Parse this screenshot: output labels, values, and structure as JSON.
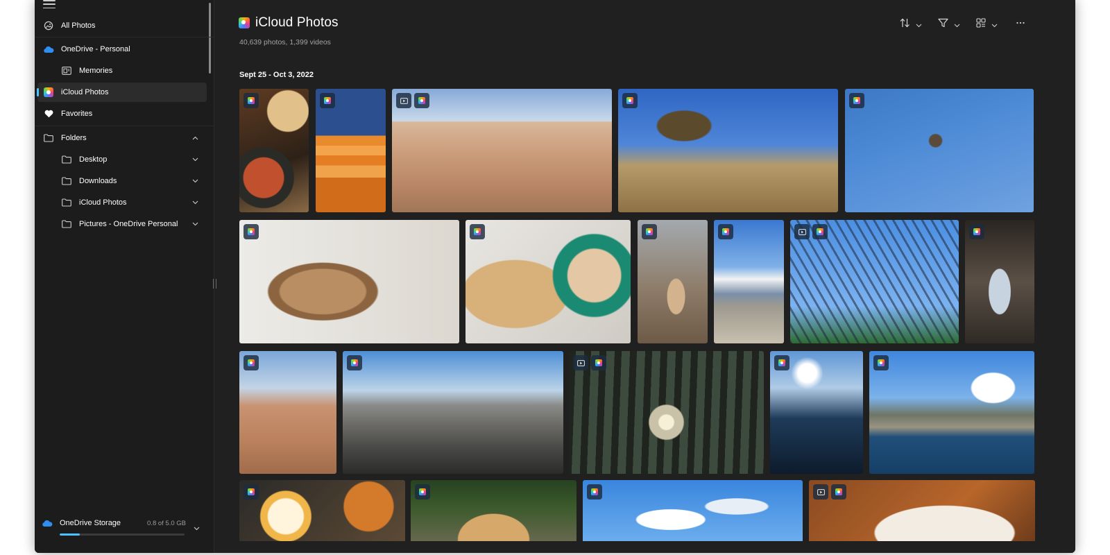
{
  "sidebar": {
    "items": [
      {
        "label": "All Photos",
        "icon": "all-photos-icon"
      },
      {
        "label": "OneDrive - Personal",
        "icon": "onedrive-cloud-icon"
      },
      {
        "label": "Memories",
        "icon": "memories-icon"
      },
      {
        "label": "iCloud Photos",
        "icon": "icloud-photos-icon"
      },
      {
        "label": "Favorites",
        "icon": "heart-icon"
      },
      {
        "label": "Folders",
        "icon": "folder-icon"
      },
      {
        "label": "Desktop",
        "icon": "folder-icon"
      },
      {
        "label": "Downloads",
        "icon": "folder-icon"
      },
      {
        "label": "iCloud Photos",
        "icon": "folder-icon"
      },
      {
        "label": "Pictures - OneDrive Personal",
        "icon": "folder-icon"
      }
    ],
    "storage": {
      "label": "OneDrive Storage",
      "amount": "0.8 of 5.0 GB",
      "used_fraction": 0.16
    }
  },
  "header": {
    "title": "iCloud Photos",
    "subtitle": "40,639 photos, 1,399 videos"
  },
  "toolbar": [
    "sort-icon",
    "filter-icon",
    "view-options-icon",
    "more-icon"
  ],
  "section_date": "Sept 25 - Oct 3, 2022",
  "colors": {
    "accent": "#4cc2ff",
    "window_bg": "#202020",
    "sidebar_bg": "#1c1c1c"
  },
  "photos": [
    {
      "name": "photo-brunch-skillet",
      "video": false
    },
    {
      "name": "photo-orange-wall",
      "video": false
    },
    {
      "name": "photo-desert-rocks-hiker",
      "video": true
    },
    {
      "name": "photo-joshua-tree",
      "video": false
    },
    {
      "name": "photo-swing-ride",
      "video": false
    },
    {
      "name": "photo-dog-on-chair",
      "video": false
    },
    {
      "name": "photo-pear-tart-latte",
      "video": false
    },
    {
      "name": "photo-dog-on-street",
      "video": false
    },
    {
      "name": "photo-bikes-by-beach",
      "video": false
    },
    {
      "name": "photo-eiffel-tower",
      "video": true
    },
    {
      "name": "photo-louvre-arch",
      "video": false
    },
    {
      "name": "photo-desert-hiker",
      "video": false
    },
    {
      "name": "photo-city-mountains",
      "video": false
    },
    {
      "name": "photo-forest-sunrays",
      "video": true
    },
    {
      "name": "photo-sunlit-shore",
      "video": false
    },
    {
      "name": "photo-lake-cliffs",
      "video": false
    },
    {
      "name": "photo-rice-bowl-egg",
      "video": false
    },
    {
      "name": "photo-dog-on-rocks",
      "video": false
    },
    {
      "name": "photo-clouds-sky",
      "video": false
    },
    {
      "name": "photo-dessert-plate",
      "video": true
    }
  ]
}
